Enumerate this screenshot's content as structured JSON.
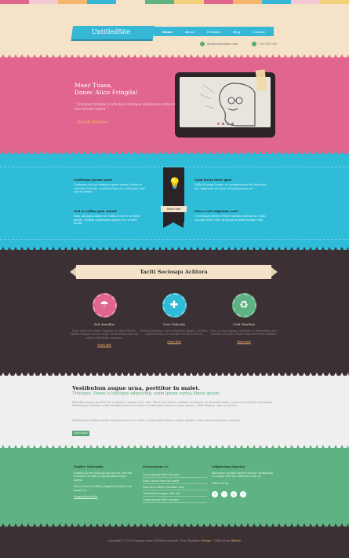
{
  "colors": {
    "cream": "#f4e3c8",
    "pink": "#e0668f",
    "cyan": "#2fbcd8",
    "dark": "#3b3034",
    "green": "#5fb283",
    "orange": "#f7b56b"
  },
  "stripe_colors": [
    "#e0668f",
    "#f4c9d6",
    "#f7b56b",
    "#36b7d6",
    "#f4e3c8",
    "#5fb283",
    "#f2d27a",
    "#e0668f",
    "#f7b56b",
    "#36b7d6",
    "#f4c9d6",
    "#f2d27a"
  ],
  "header": {
    "logo": "UntitledSite",
    "nav": [
      {
        "label": "Home",
        "active": true
      },
      {
        "label": "About"
      },
      {
        "label": "Portfolio"
      },
      {
        "label": "Blog"
      },
      {
        "label": "Contact"
      }
    ],
    "email": "info@untitledsite.com",
    "phone": "+00 000 000"
  },
  "hero": {
    "title_line1": "Maec Tuasa,",
    "title_line2": "Donec Alico Fringila!",
    "quote": "\" Vivamus tristique lorem diam tristique adipiscing enimcon uno laoreet sapien \"",
    "author": "- Smith Holmes",
    "slider_dots": 4
  },
  "features": {
    "items": [
      {
        "title": "Curlomus jacum amet",
        "text": "Curtamos ut nun tetiquior quam sontus luctus at est nunc lobortis, condimentum nec volutpatis ante sontus lorem."
      },
      {
        "title": "Nam lacus vitae quat",
        "text": "Nulla id quam lorem, et condimentum dui tincidunt nec dignissim mi fusce at ligula ipsum est."
      },
      {
        "title": "Sed ac tellus quis Antale",
        "text": "Nam ulo ipsun dolor sit. Nulla at est et sit ibulo mattis. Nullam malesuada mauris est, id ante lorem."
      },
      {
        "title": "Fusce sed vulputate ante",
        "text": "Ut volutpat lorem et fusce iaculis velit luctus. Nam suscipit nulla vitae ut ipsum at pellentesque erat."
      }
    ],
    "more_label": "More Info"
  },
  "services": {
    "heading": "Taciti Sociosqu Aclitora",
    "items": [
      {
        "title": "Sed Aenellus",
        "icon": "umbrella-icon",
        "glyph": "☂",
        "color": "#e0668f",
        "text": "Nunc eget velit lorem. Vivamus sit amet lobortis. Mauris tempus orci nec nulla. Sed pretium risus vel augue sollicitudin tincidunt.",
        "link": "More Info"
      },
      {
        "title": "Cras Vehicula",
        "icon": "puzzle-icon",
        "glyph": "✚",
        "color": "#2fbcd8",
        "text": "Mauris dignissim, justo at facilisis aliquet, mi libero sagittis massa, in convallis est elit at lorem.",
        "link": "More Info"
      },
      {
        "title": "Cedi Nitulitas",
        "icon": "recycle-icon",
        "glyph": "♻",
        "color": "#5fb283",
        "text": "Nunc ut nunc ipsum, vulputate ac fermentum eget, ultricies vel dolor. Etiam vulputate lorem dapibus.",
        "link": "More Info"
      }
    ]
  },
  "about": {
    "heading": "Vestibulum augue urna, porttitor in malet.",
    "subheading": "Tristique. Donec a tristique adipiscing, enim ipsum varius libero ipsum.",
    "para1": "Phasellus tempor porttitor leo a egestas. Quisque ut ac velit. Etiam arcu lorem, volutpat et volutpat est, tincidunt nulla, a porta ante facilisis elementum. Pellentesque habitant morbi tristique senectus et netus et malesuada fames ac turpis egestas. Nulla dapibus, odio nec lacinia.",
    "para2": "Pellentesque habitant morbi tristique senectus et netus et malesuada fames ac turpis egestas. Nam vitae ipsum porta commodo.",
    "button": "More Info"
  },
  "footer": {
    "col1": {
      "title": "Dopler Malesada",
      "text1": "Vivamus lectus volutpat nisl at erat. Sed dui. Praesent vel nulla ac ipsum ullamcorper mattis.",
      "text2": "Fusce at ante et libero dapibus facilisis et ut mauris in.",
      "link": "Consectetur dolor"
    },
    "col2": {
      "title": "Fermentum Lo",
      "links": [
        "Lorem ipsum dolor sit amet",
        "Nunc varius risus fact amet",
        "Nam lacus libero tincidunt erat",
        "Vestibulum tempus velit sem",
        "Lorem ipsum dolor sit amet"
      ]
    },
    "col3": {
      "title": "Adipiscing Egestas",
      "text": "Maecenas est nibh laoreet vel nisl. Vestibulum et tempor velit nec ultricies lorem sit.",
      "follow": "Follow us on",
      "social": [
        "f",
        "t",
        "g",
        "r"
      ]
    }
  },
  "copyright": {
    "text": "Copyright © 2013 Company name All rights reserved. More Templates",
    "link1": "Design",
    "middle": " - Collect from ",
    "link2": "Website"
  }
}
